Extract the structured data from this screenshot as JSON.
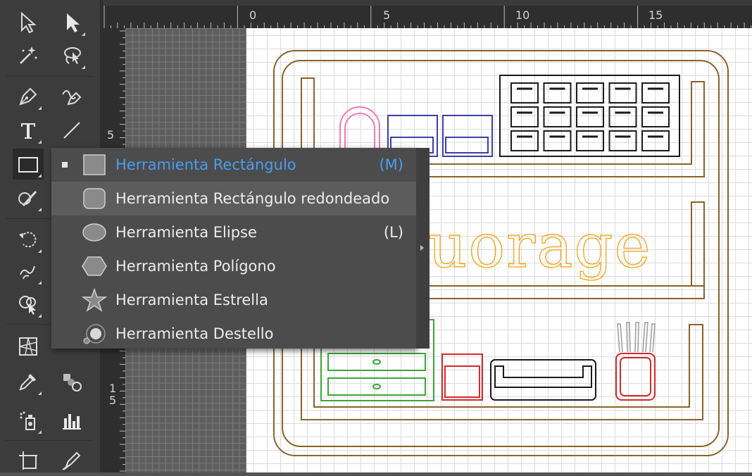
{
  "toolbar": {
    "tools": [
      {
        "name": "selection-tool",
        "icon": "selection-arrow-icon"
      },
      {
        "name": "direct-selection-tool",
        "icon": "direct-selection-arrow-icon"
      },
      {
        "name": "magic-wand-tool",
        "icon": "magic-wand-icon"
      },
      {
        "name": "lasso-tool",
        "icon": "lasso-icon"
      },
      {
        "name": "pen-tool",
        "icon": "pen-icon"
      },
      {
        "name": "curvature-tool",
        "icon": "curvature-pen-icon"
      },
      {
        "name": "type-tool",
        "icon": "type-icon"
      },
      {
        "name": "line-tool",
        "icon": "line-segment-icon"
      },
      {
        "name": "rectangle-tool",
        "icon": "rectangle-icon",
        "active": true
      },
      {
        "name": "shaper-tool",
        "icon": "shaper-pencil-icon"
      },
      {
        "name": "rotate-tool",
        "icon": "rotate-icon"
      },
      {
        "name": "warp-tool",
        "icon": "warp-icon"
      },
      {
        "name": "shape-builder-tool",
        "icon": "shape-builder-icon"
      },
      {
        "name": "perspective-grid-tool",
        "icon": "perspective-grid-icon"
      },
      {
        "name": "eyedropper-tool",
        "icon": "eyedropper-icon"
      },
      {
        "name": "blend-tool",
        "icon": "blend-icon"
      },
      {
        "name": "symbol-sprayer-tool",
        "icon": "symbol-sprayer-icon"
      },
      {
        "name": "column-graph-tool",
        "icon": "column-graph-icon"
      },
      {
        "name": "artboard-tool",
        "icon": "artboard-icon"
      },
      {
        "name": "slice-tool",
        "icon": "slice-icon"
      }
    ]
  },
  "rulers": {
    "horizontal": [
      "0",
      "5",
      "10",
      "15"
    ],
    "vertical": [
      "5",
      "1",
      "5"
    ]
  },
  "flyout": {
    "items": [
      {
        "label": "Herramienta Rectángulo",
        "shortcut": "(M)",
        "icon": "rectangle-icon",
        "selected": true
      },
      {
        "label": "Herramienta Rectángulo redondeado",
        "shortcut": "",
        "icon": "rounded-rectangle-icon",
        "hover": true
      },
      {
        "label": "Herramienta Elipse",
        "shortcut": "(L)",
        "icon": "ellipse-icon"
      },
      {
        "label": "Herramienta Polígono",
        "shortcut": "",
        "icon": "polygon-icon"
      },
      {
        "label": "Herramienta Estrella",
        "shortcut": "",
        "icon": "star-icon"
      },
      {
        "label": "Herramienta Destello",
        "shortcut": "",
        "icon": "flare-icon"
      }
    ]
  },
  "artwork": {
    "visible_text": "uorage",
    "colors": {
      "frame": "#8b6326",
      "text": "#f2a313",
      "pink": "#f07ab8",
      "blue": "#3d3fa8",
      "black": "#1a1a1a",
      "green": "#3aa63a",
      "red": "#d42a2a",
      "gray": "#9a9a9a"
    }
  },
  "colors": {
    "accent": "#4b9cf0",
    "toolbar_bg": "#3c3c3c",
    "menu_bg": "#4c4c4c",
    "menu_hover": "#5c5c5c"
  }
}
